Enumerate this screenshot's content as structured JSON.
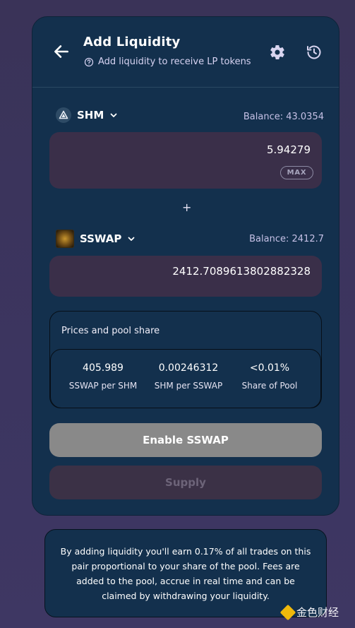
{
  "header": {
    "title": "Add Liquidity",
    "subtitle": "Add liquidity to receive LP tokens"
  },
  "token_a": {
    "symbol": "SHM",
    "balance": "Balance: 43.0354",
    "amount": "5.94279",
    "max_label": "MAX"
  },
  "plus_sign": "+",
  "token_b": {
    "symbol": "SSWAP",
    "balance": "Balance: 2412.7",
    "amount": "2412.7089613802882328"
  },
  "pool": {
    "title": "Prices and pool share",
    "stats": [
      {
        "value": "405.989",
        "label": "SSWAP per SHM"
      },
      {
        "value": "0.00246312",
        "label": "SHM per SSWAP"
      },
      {
        "value": "<0.01%",
        "label": "Share of Pool"
      }
    ]
  },
  "buttons": {
    "enable": "Enable SSWAP",
    "supply": "Supply"
  },
  "info": {
    "text": "By adding liquidity you'll earn 0.17% of all trades on this pair proportional to your share of the pool. Fees are added to the pool, accrue in real time and can be claimed by withdrawing your liquidity."
  },
  "watermark": {
    "text": "金色财经"
  },
  "colors": {
    "card_bg": "#13304d",
    "input_bg": "#3a2f49",
    "enable_bg": "#898989",
    "supply_bg": "#3b3146"
  }
}
